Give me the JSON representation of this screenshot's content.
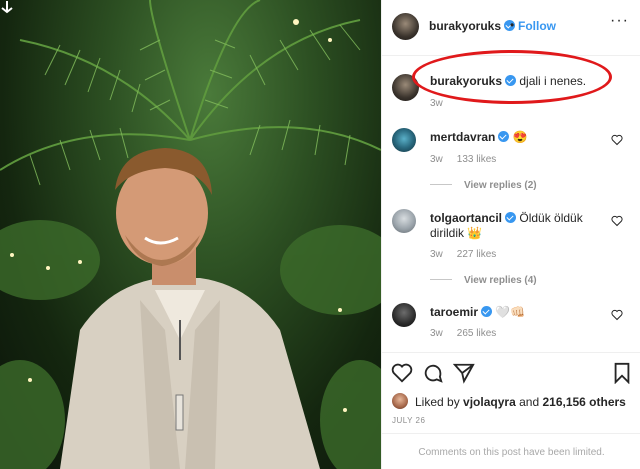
{
  "post": {
    "username": "burakyoruks",
    "follow_label": "Follow",
    "separator": "•",
    "more_label": "···"
  },
  "caption": {
    "username": "burakyoruks",
    "text": "djali i nenes.",
    "age": "3w"
  },
  "comments": [
    {
      "username": "mertdavran",
      "text": "😍",
      "age": "3w",
      "likes": "133 likes",
      "replies": "View replies (2)"
    },
    {
      "username": "tolgaortancil",
      "text": "Öldük öldük dirildik 👑",
      "age": "3w",
      "likes": "227 likes",
      "replies": "View replies (4)"
    },
    {
      "username": "taroemir",
      "text": "🤍👊🏻",
      "age": "3w",
      "likes": "265 likes"
    }
  ],
  "liked_by": {
    "prefix": "Liked by",
    "user": "vjolaqyra",
    "conjunction": "and",
    "others": "216,156 others"
  },
  "date": "JULY 26",
  "comments_limited": "Comments on this post have been limited.",
  "icons": [
    "download-arrow-icon",
    "verified-badge-icon",
    "more-icon",
    "heart-icon",
    "comment-icon",
    "share-icon",
    "bookmark-icon"
  ],
  "colors": {
    "accent": "#3897f0",
    "annotation": "#e0191b",
    "muted": "#8e8e8e"
  }
}
